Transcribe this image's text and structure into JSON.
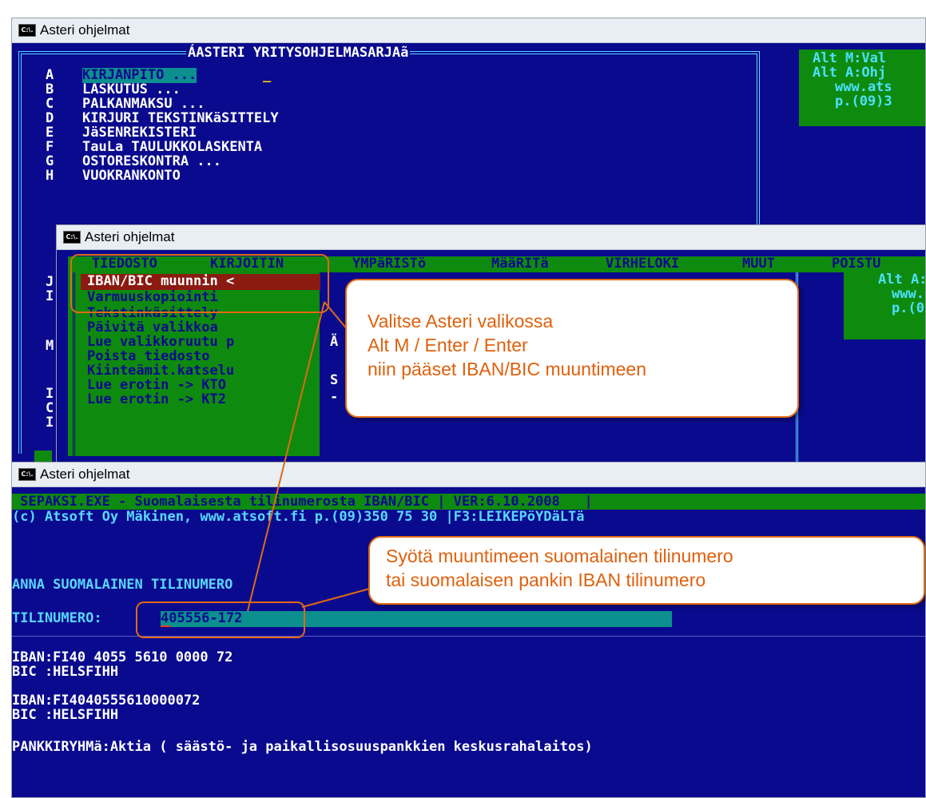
{
  "windows": {
    "title": "Asteri ohjelmat",
    "icon_label": "C:\\."
  },
  "main_menu": {
    "header": "ÁASTERI YRITYSOHJELMASARJAã",
    "letters": [
      "A",
      "B",
      "C",
      "D",
      "E",
      "F",
      "G",
      "H"
    ],
    "items": [
      "KIRJANPITO ...",
      "LASKUTUS ...",
      "PALKANMAKSU ...",
      "KIRJURI TEKSTINKäSITTELY",
      "JäSENREKISTERI",
      "TauLa TAULUKKOLASKENTA",
      "OSTORESKONTRA ...",
      "VUOKRANKONTO"
    ],
    "side_box": [
      "Alt M:Val",
      "Alt A:Ohj",
      "www.ats",
      "p.(09)3"
    ]
  },
  "menu_window": {
    "menubar": [
      "TIEDOSTO",
      "KIRJOITIN",
      "YMPäRISTö",
      "MääRITä",
      "VIRHELOKI",
      "MUUT",
      "POISTU"
    ],
    "items": [
      "IBAN/BIC muunnin <",
      "Varmuuskopiointi",
      "Tekstinkäsittely",
      "Päivitä valikkoa",
      "Lue valikkoruutu p",
      "Poista tiedosto",
      "Kiinteämit.katselu",
      "Lue erotin -> KTO",
      "Lue erotin -> KT2"
    ],
    "side_box": [
      "Alt A:",
      "www.",
      "p.(0"
    ],
    "stray": [
      "Ä",
      "S",
      "-"
    ]
  },
  "callouts": {
    "menu": [
      "Valitse Asteri valikossa",
      "Alt M / Enter / Enter",
      "niin pääset IBAN/BIC muuntimeen"
    ],
    "input": [
      "Syötä muuntimeen suomalainen tilinumero",
      "tai suomalaisen pankin IBAN tilinumero"
    ]
  },
  "converter": {
    "header_line": " SEPAKSI.EXE - Suomalaisesta tilinumerosta IBAN/BIC | VER:6.10.2008   |",
    "copyright_line": "(c) Atsoft Oy Mäkinen, www.atsoft.fi p.(09)350 75 30 |F3:LEIKEPöYDäLTä",
    "prompt": "ANNA SUOMALAINEN TILINUMERO",
    "field_label": "TILINUMERO:",
    "field_value": "405556-172",
    "iban_formatted": "IBAN:FI40 4055 5610 0000 72",
    "bic1": "BIC :HELSFIHH",
    "iban_plain": "IBAN:FI4040555610000072",
    "bic2": "BIC :HELSFIHH",
    "bank_group": "PANKKIRYHMä:Aktia ( säästö- ja paikallisosuuspankkien keskusrahalaitos)"
  },
  "colors": {
    "console_bg": "#0a0a8e",
    "highlight_bg": "#0e8a0e",
    "input_bg": "#0b8f8f",
    "accent": "#e06a14"
  }
}
